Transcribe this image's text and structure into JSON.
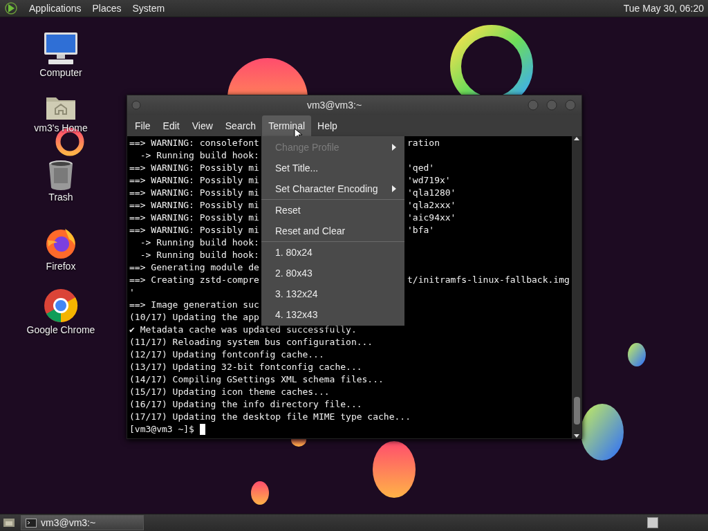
{
  "top_panel": {
    "menus": [
      "Applications",
      "Places",
      "System"
    ],
    "clock": "Tue May 30, 06:20"
  },
  "desktop_icons": [
    {
      "kind": "computer",
      "label": "Computer"
    },
    {
      "kind": "home",
      "label": "vm3's Home"
    },
    {
      "kind": "trash",
      "label": "Trash"
    },
    {
      "kind": "firefox",
      "label": "Firefox"
    },
    {
      "kind": "chrome",
      "label": "Google Chrome"
    }
  ],
  "window": {
    "title": "vm3@vm3:~",
    "menubar": [
      {
        "label": "File",
        "selected": false
      },
      {
        "label": "Edit",
        "selected": false
      },
      {
        "label": "View",
        "selected": false
      },
      {
        "label": "Search",
        "selected": false
      },
      {
        "label": "Terminal",
        "selected": true
      },
      {
        "label": "Help",
        "selected": false
      }
    ],
    "terminal_lines": [
      {
        "text": "==> WARNING: consolefont",
        "tail": "ration"
      },
      {
        "text": "  -> Running build hook:"
      },
      {
        "text": "==> WARNING: Possibly mi",
        "tail": "'qed'"
      },
      {
        "text": "==> WARNING: Possibly mi",
        "tail": "'wd719x'"
      },
      {
        "text": "==> WARNING: Possibly mi",
        "tail": "'qla1280'"
      },
      {
        "text": "==> WARNING: Possibly mi",
        "tail": "'qla2xxx'"
      },
      {
        "text": "==> WARNING: Possibly mi",
        "tail": "'aic94xx'"
      },
      {
        "text": "==> WARNING: Possibly mi",
        "tail": "'bfa'"
      },
      {
        "text": "  -> Running build hook:"
      },
      {
        "text": "  -> Running build hook:"
      },
      {
        "text": "==> Generating module de"
      },
      {
        "text": "==> Creating zstd-compre",
        "tail": "t/initramfs-linux-fallback.img"
      },
      {
        "text": "'"
      },
      {
        "text": "==> Image generation suc"
      },
      {
        "text": "(10/17) Updating the app"
      },
      {
        "text": "✔ Metadata cache was updated successfully."
      },
      {
        "text": "(11/17) Reloading system bus configuration..."
      },
      {
        "text": "(12/17) Updating fontconfig cache..."
      },
      {
        "text": "(13/17) Updating 32-bit fontconfig cache..."
      },
      {
        "text": "(14/17) Compiling GSettings XML schema files..."
      },
      {
        "text": "(15/17) Updating icon theme caches..."
      },
      {
        "text": "(16/17) Updating the info directory file..."
      },
      {
        "text": "(17/17) Updating the desktop file MIME type cache..."
      }
    ],
    "prompt": "[vm3@vm3 ~]$",
    "dropdown": [
      {
        "kind": "item",
        "label": "Change Profile",
        "disabled": true,
        "submenu": true
      },
      {
        "kind": "item",
        "label": "Set Title...",
        "disabled": false,
        "submenu": false
      },
      {
        "kind": "item",
        "label": "Set Character Encoding",
        "disabled": false,
        "submenu": true
      },
      {
        "kind": "separator"
      },
      {
        "kind": "item",
        "label": "Reset",
        "disabled": false,
        "submenu": false
      },
      {
        "kind": "item",
        "label": "Reset and Clear",
        "disabled": false,
        "submenu": false
      },
      {
        "kind": "separator"
      },
      {
        "kind": "item",
        "label": "1. 80x24",
        "disabled": false,
        "submenu": false
      },
      {
        "kind": "item",
        "label": "2. 80x43",
        "disabled": false,
        "submenu": false
      },
      {
        "kind": "item",
        "label": "3. 132x24",
        "disabled": false,
        "submenu": false
      },
      {
        "kind": "item",
        "label": "4. 132x43",
        "disabled": false,
        "submenu": false
      }
    ]
  },
  "taskbar": {
    "tasks": [
      {
        "label": "vm3@vm3:~"
      }
    ]
  }
}
